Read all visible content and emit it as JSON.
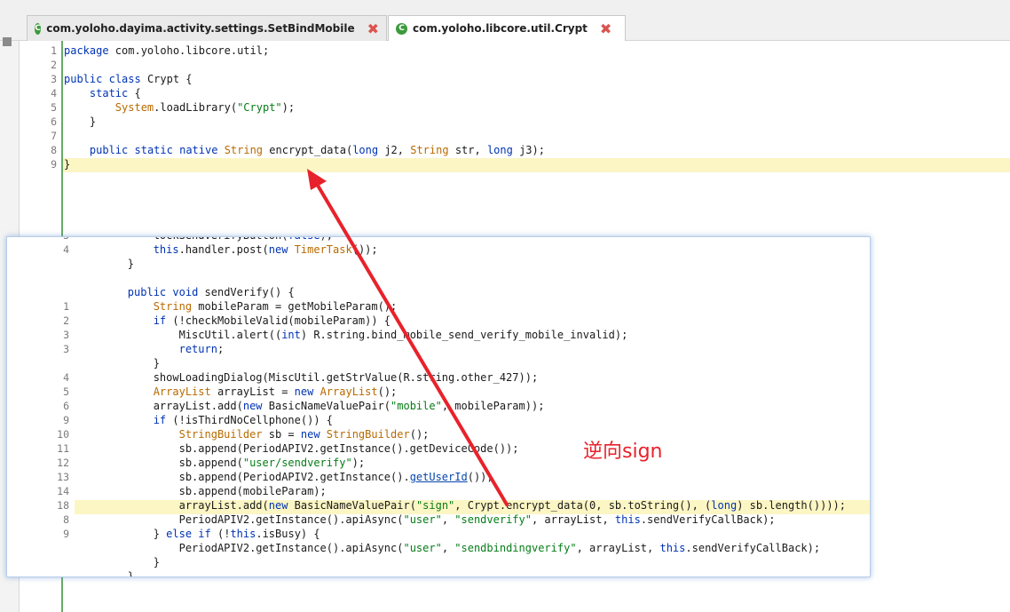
{
  "tabs": [
    {
      "label": "com.yoloho.dayima.activity.settings.SetBindMobile"
    },
    {
      "label": "com.yoloho.libcore.util.Crypt"
    }
  ],
  "editor1": {
    "line_numbers": [
      "1",
      "2",
      "3",
      "4",
      "5",
      "6",
      "7",
      "8",
      "9"
    ],
    "lines": [
      "package com.yoloho.libcore.util;",
      "",
      "public class Crypt {",
      "    static {",
      "        System.loadLibrary(\"Crypt\");",
      "    }",
      "",
      "    public static native String encrypt_data(long j2, String str, long j3);",
      "}"
    ]
  },
  "popup": {
    "line_numbers": [
      "3",
      "4",
      "",
      "",
      "",
      "1",
      "2",
      "3",
      "3",
      "",
      "4",
      "5",
      "6",
      "9",
      "10",
      "11",
      "12",
      "13",
      "14",
      "18",
      "8",
      "9",
      "",
      "",
      ""
    ],
    "lines": [
      "            lockSendVerifyButton(false);",
      "            this.handler.post(new TimerTask());",
      "        }",
      "",
      "        public void sendVerify() {",
      "            String mobileParam = getMobileParam();",
      "            if (!checkMobileValid(mobileParam)) {",
      "                MiscUtil.alert((int) R.string.bind_mobile_send_verify_mobile_invalid);",
      "                return;",
      "            }",
      "            showLoadingDialog(MiscUtil.getStrValue(R.string.other_427));",
      "            ArrayList arrayList = new ArrayList();",
      "            arrayList.add(new BasicNameValuePair(\"mobile\", mobileParam));",
      "            if (!isThirdNoCellphone()) {",
      "                StringBuilder sb = new StringBuilder();",
      "                sb.append(PeriodAPIV2.getInstance().getDeviceCode());",
      "                sb.append(\"user/sendverify\");",
      "                sb.append(PeriodAPIV2.getInstance().getUserId());",
      "                sb.append(mobileParam);",
      "                arrayList.add(new BasicNameValuePair(\"sign\", Crypt.encrypt_data(0, sb.toString(), (long) sb.length())));",
      "                PeriodAPIV2.getInstance().apiAsync(\"user\", \"sendverify\", arrayList, this.sendVerifyCallBack);",
      "            } else if (!this.isBusy) {",
      "                PeriodAPIV2.getInstance().apiAsync(\"user\", \"sendbindingverify\", arrayList, this.sendVerifyCallBack);",
      "            }",
      "        }"
    ]
  },
  "annotation": {
    "text": "逆向sign",
    "color": "#e8222a"
  },
  "colors": {
    "keyword": "#0033b3",
    "type": "#b86a00",
    "string": "#067d17",
    "highlight": "#fcf6c5",
    "arrow": "#e8222a"
  }
}
